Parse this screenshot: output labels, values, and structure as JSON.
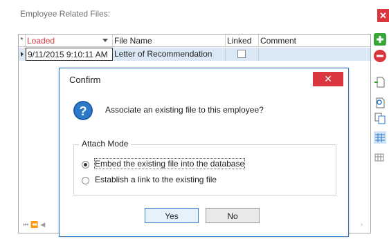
{
  "panel": {
    "title": "Employee Related Files:",
    "close_glyph": "✕"
  },
  "grid": {
    "columns": [
      "Loaded",
      "File Name",
      "Linked",
      "Comment"
    ],
    "row": {
      "loaded": "9/11/2015 9:10:11 AM",
      "file_name": "Letter of Recommendation",
      "linked": false,
      "comment": ""
    }
  },
  "dialog": {
    "title": "Confirm",
    "close_glyph": "✕",
    "message": "Associate an existing file to this employee?",
    "group_label": "Attach Mode",
    "options": [
      {
        "label": "Embed the existing file into the database",
        "selected": true
      },
      {
        "label": "Establish a link to the existing file",
        "selected": false
      }
    ],
    "yes_label": "Yes",
    "no_label": "No"
  },
  "colors": {
    "accent": "#2b79c8",
    "close": "#d9363e",
    "selection": "#dae7f5"
  }
}
